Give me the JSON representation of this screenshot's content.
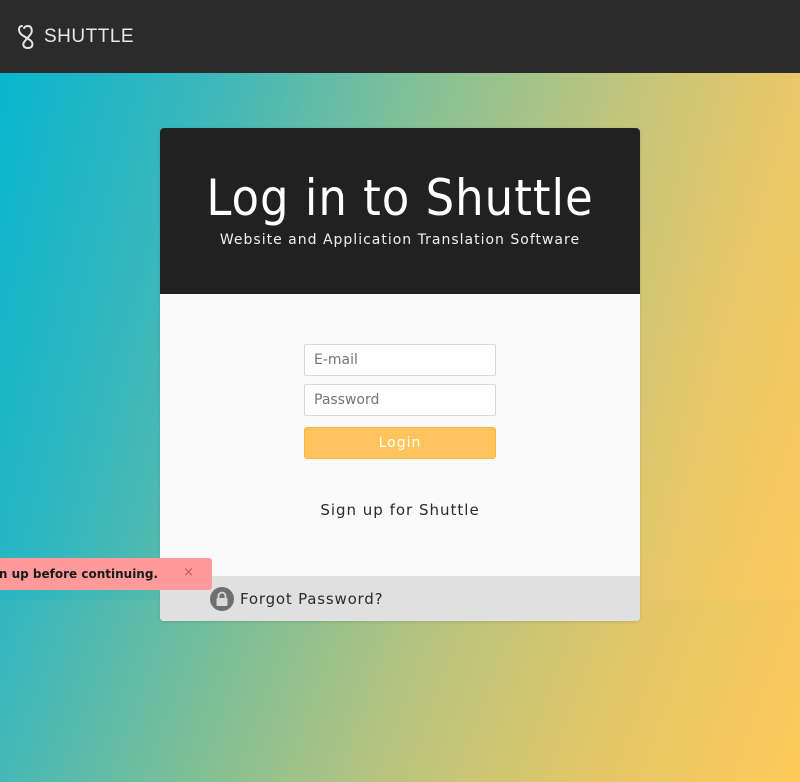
{
  "header": {
    "brand_name": "SHUTTLE",
    "brand_icon": "shuttle-logo-icon"
  },
  "login": {
    "title": "Log in to Shuttle",
    "subtitle": "Website and Application Translation Software",
    "email_placeholder": "E-mail",
    "email_value": "",
    "password_placeholder": "Password",
    "password_value": "",
    "login_button": "Login",
    "signup_link": "Sign up for Shuttle",
    "forgot_link": "Forgot Password?",
    "forgot_icon": "lock-icon",
    "accent_color": "#ffc45c"
  },
  "flash": {
    "message": "You need to sign in or sign up before continuing.",
    "close": "×",
    "color": "#ff9a9a"
  }
}
